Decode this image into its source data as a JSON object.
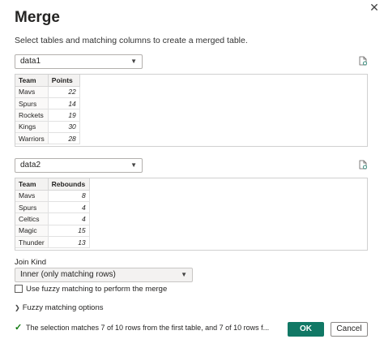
{
  "dialog": {
    "title": "Merge",
    "subtitle": "Select tables and matching columns to create a merged table.",
    "close_glyph": "✕"
  },
  "table1": {
    "selected": "data1",
    "headers": [
      "Team",
      "Points"
    ],
    "rows": [
      [
        "Mavs",
        "22"
      ],
      [
        "Spurs",
        "14"
      ],
      [
        "Rockets",
        "19"
      ],
      [
        "Kings",
        "30"
      ],
      [
        "Warriors",
        "28"
      ]
    ]
  },
  "table2": {
    "selected": "data2",
    "headers": [
      "Team",
      "Rebounds"
    ],
    "rows": [
      [
        "Mavs",
        "8"
      ],
      [
        "Spurs",
        "4"
      ],
      [
        "Celtics",
        "4"
      ],
      [
        "Magic",
        "15"
      ],
      [
        "Thunder",
        "13"
      ]
    ]
  },
  "join": {
    "label": "Join Kind",
    "selected": "Inner (only matching rows)"
  },
  "fuzzy": {
    "checkbox_label": "Use fuzzy matching to perform the merge",
    "options_label": "Fuzzy matching options"
  },
  "status": {
    "text": "The selection matches 7 of 10 rows from the first table, and 7 of 10 rows f..."
  },
  "buttons": {
    "ok": "OK",
    "cancel": "Cancel"
  },
  "colors": {
    "ok_button": "#117865",
    "check": "#0e7a0d"
  }
}
